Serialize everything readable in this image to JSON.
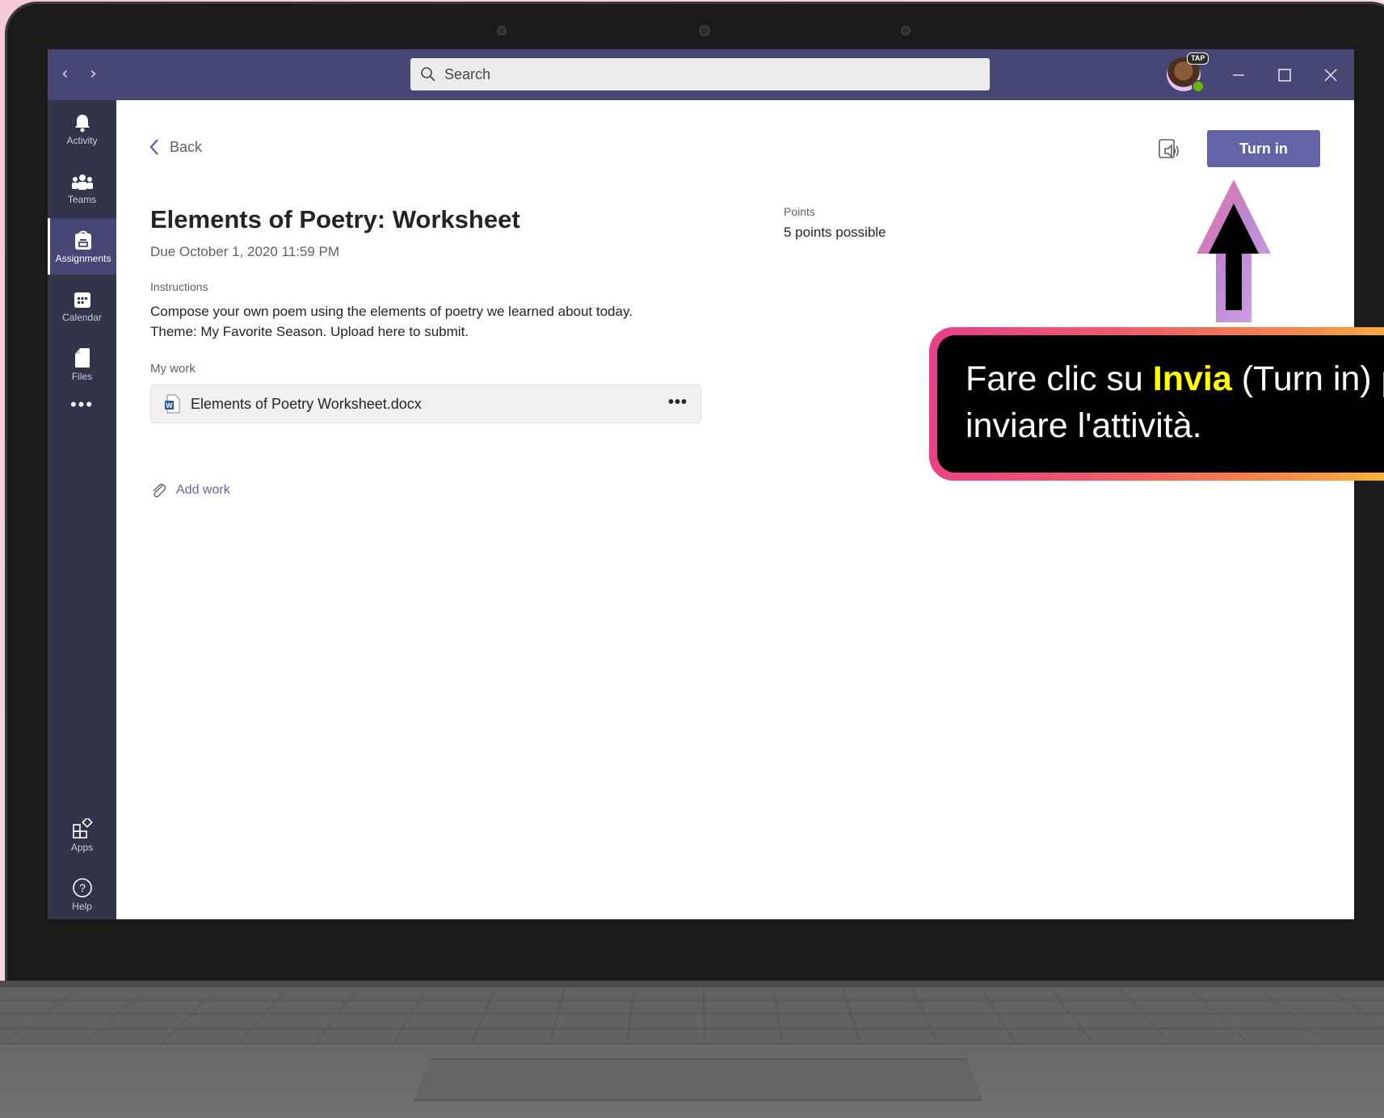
{
  "titlebar": {
    "search_placeholder": "Search",
    "badge": "TAP",
    "back_nav": "‹",
    "forward_nav": "›"
  },
  "rail": {
    "items": [
      {
        "label": "Activity",
        "icon": "bell-icon"
      },
      {
        "label": "Teams",
        "icon": "teams-icon"
      },
      {
        "label": "Assignments",
        "icon": "assignments-icon"
      },
      {
        "label": "Calendar",
        "icon": "calendar-icon"
      },
      {
        "label": "Files",
        "icon": "file-icon"
      },
      {
        "label": "•••",
        "icon": "more-icon"
      }
    ],
    "bottom": [
      {
        "label": "Apps",
        "icon": "apps-icon"
      },
      {
        "label": "Help",
        "icon": "help-icon"
      }
    ]
  },
  "assignment": {
    "back_label": "Back",
    "turn_in_label": "Turn in",
    "title": "Elements of Poetry: Worksheet",
    "due": "Due October 1, 2020 11:59 PM",
    "points_label": "Points",
    "points_value": "5 points possible",
    "instructions_label": "Instructions",
    "instructions_line1": "Compose your own poem using the elements of poetry we learned about today.",
    "instructions_line2": "Theme: My Favorite Season. Upload here to submit.",
    "my_work_label": "My work",
    "file_name": "Elements of Poetry Worksheet.docx",
    "file_more": "•••",
    "add_work_label": "Add work"
  },
  "callout": {
    "pre": "Fare clic su ",
    "highlight": "Invia",
    "post": " (Turn in) per",
    "line2": "inviare l'attività."
  },
  "colors": {
    "teams_purple": "#6264a7",
    "titlebar": "#464775",
    "rail": "#33344a",
    "callout_highlight": "#ffff00"
  }
}
